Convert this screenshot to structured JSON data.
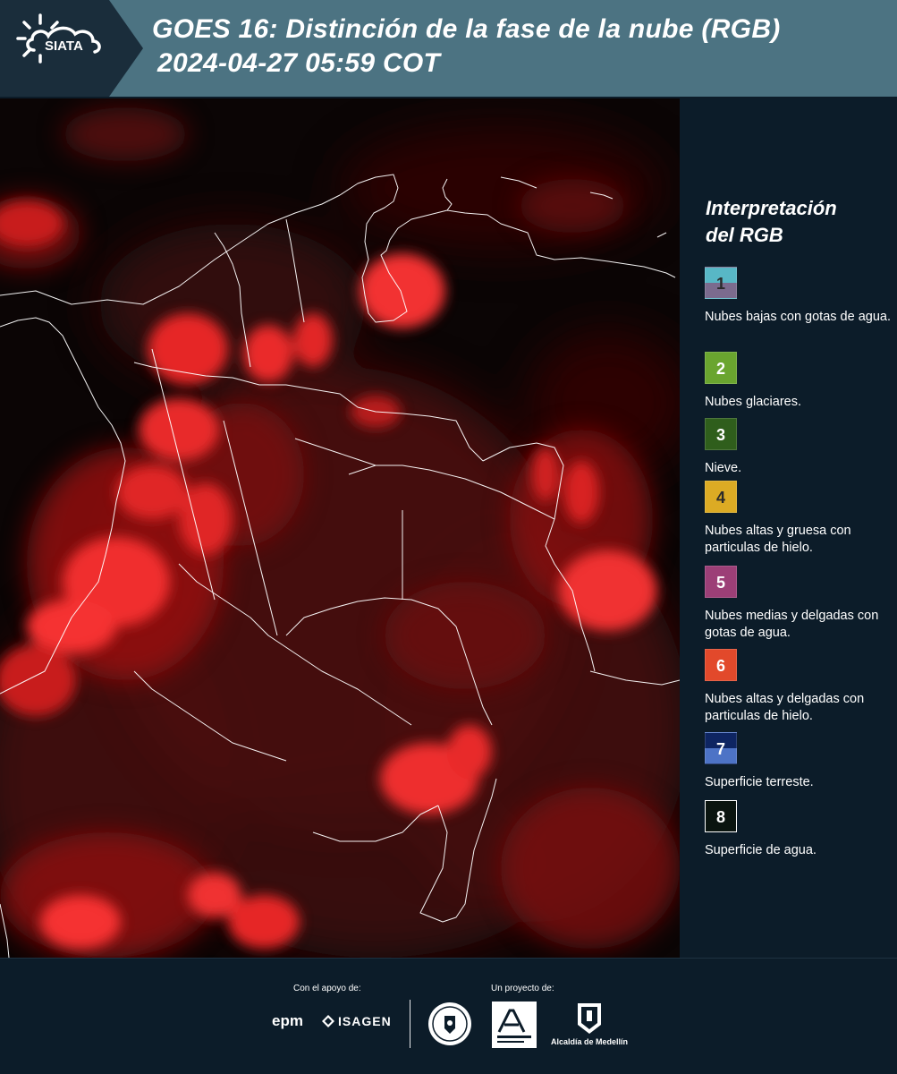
{
  "header": {
    "logo_text": "SIATA",
    "title_line1": "GOES 16: Distinción de la fase de la nube (RGB)",
    "title_line2": "2024-04-27 05:59 COT",
    "background_color": "#4c7382"
  },
  "legend": {
    "title_line1": "Interpretación",
    "title_line2": "del RGB",
    "items": [
      {
        "number": "1",
        "label": "Nubes bajas con gotas de agua.",
        "colors": [
          "#58b7c6",
          "#7b6b8e"
        ]
      },
      {
        "number": "2",
        "label": "Nubes glaciares.",
        "colors": [
          "#6aa52f"
        ]
      },
      {
        "number": "3",
        "label": "Nieve.",
        "colors": [
          "#2f5e1c"
        ]
      },
      {
        "number": "4",
        "label": "Nubes altas y gruesa con particulas de hielo.",
        "colors": [
          "#dcab24"
        ]
      },
      {
        "number": "5",
        "label": "Nubes medias y delgadas con gotas de agua.",
        "colors": [
          "#9c3f77"
        ]
      },
      {
        "number": "6",
        "label": "Nubes altas y delgadas con particulas de hielo.",
        "colors": [
          "#e2492b"
        ]
      },
      {
        "number": "7",
        "label": "Superficie terreste.",
        "colors": [
          "#0e2562",
          "#4d73c6"
        ]
      },
      {
        "number": "8",
        "label": "Superficie de agua.",
        "colors": [
          "#0a140f"
        ]
      }
    ]
  },
  "footer": {
    "support_label": "Con el apoyo de:",
    "project_label": "Un proyecto de:",
    "epm_logo": "epm",
    "isagen_logo": "ISAGEN",
    "area_logo": "Área Metropolitana",
    "alcaldia_logo": "Alcaldía de Medellín"
  }
}
